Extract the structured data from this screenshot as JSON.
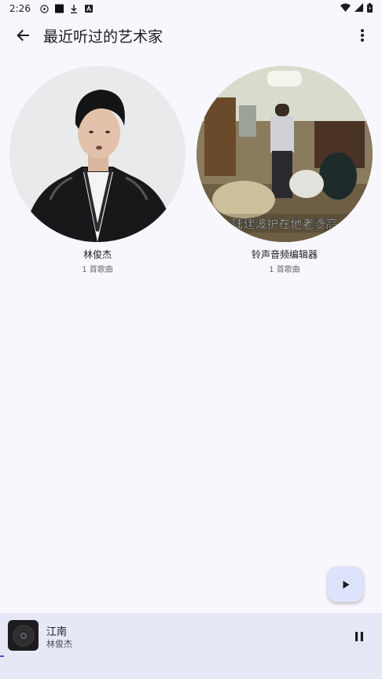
{
  "status_bar": {
    "time": "2:26",
    "icons": [
      "play-circle-icon",
      "square-icon",
      "download-icon",
      "a-badge-icon"
    ],
    "right_icons": [
      "wifi-icon",
      "signal-icon",
      "battery-icon"
    ]
  },
  "app_bar": {
    "title": "最近听过的艺术家",
    "back_icon": "arrow-left-icon",
    "menu_icon": "more-vert-icon"
  },
  "artists": [
    {
      "name": "林俊杰",
      "count": "1 首歌曲"
    },
    {
      "name": "铃声音频编辑器",
      "count": "1 首歌曲",
      "image_caption": "陆建波护在他老婆高"
    }
  ],
  "fab": {
    "icon": "play-icon"
  },
  "mini_player": {
    "title": "江南",
    "artist": "林俊杰",
    "art_icon": "vinyl-disc-icon",
    "control_icon": "pause-icon",
    "accent": "#3b5bc5"
  }
}
